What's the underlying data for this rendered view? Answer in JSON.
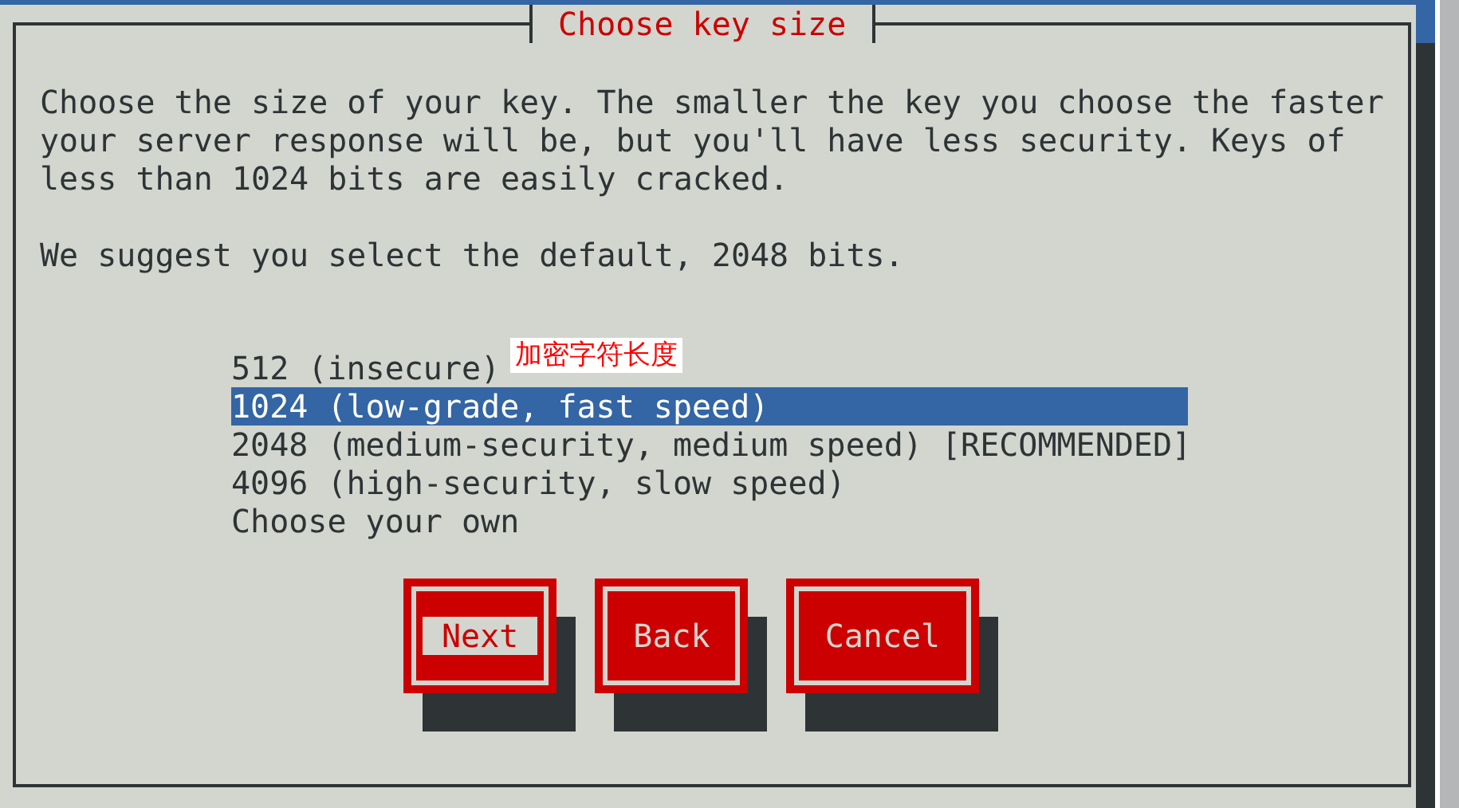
{
  "dialog": {
    "title": "Choose key size",
    "description": "Choose the size of your key. The smaller the key you choose the faster your server response will be, but you'll have less security. Keys of less than 1024 bits are easily cracked.",
    "suggestion": "We suggest you select the default, 2048 bits.",
    "options": [
      {
        "label": "512 (insecure)",
        "selected": false
      },
      {
        "label": "1024 (low-grade, fast speed)",
        "selected": true
      },
      {
        "label": "2048 (medium-security, medium speed) [RECOMMENDED]",
        "selected": false
      },
      {
        "label": "4096 (high-security, slow speed)",
        "selected": false
      },
      {
        "label": "Choose your own",
        "selected": false
      }
    ],
    "annotation": "加密字符长度",
    "buttons": [
      {
        "label": "Next",
        "focused": true
      },
      {
        "label": "Back",
        "focused": false
      },
      {
        "label": "Cancel",
        "focused": false
      }
    ]
  }
}
